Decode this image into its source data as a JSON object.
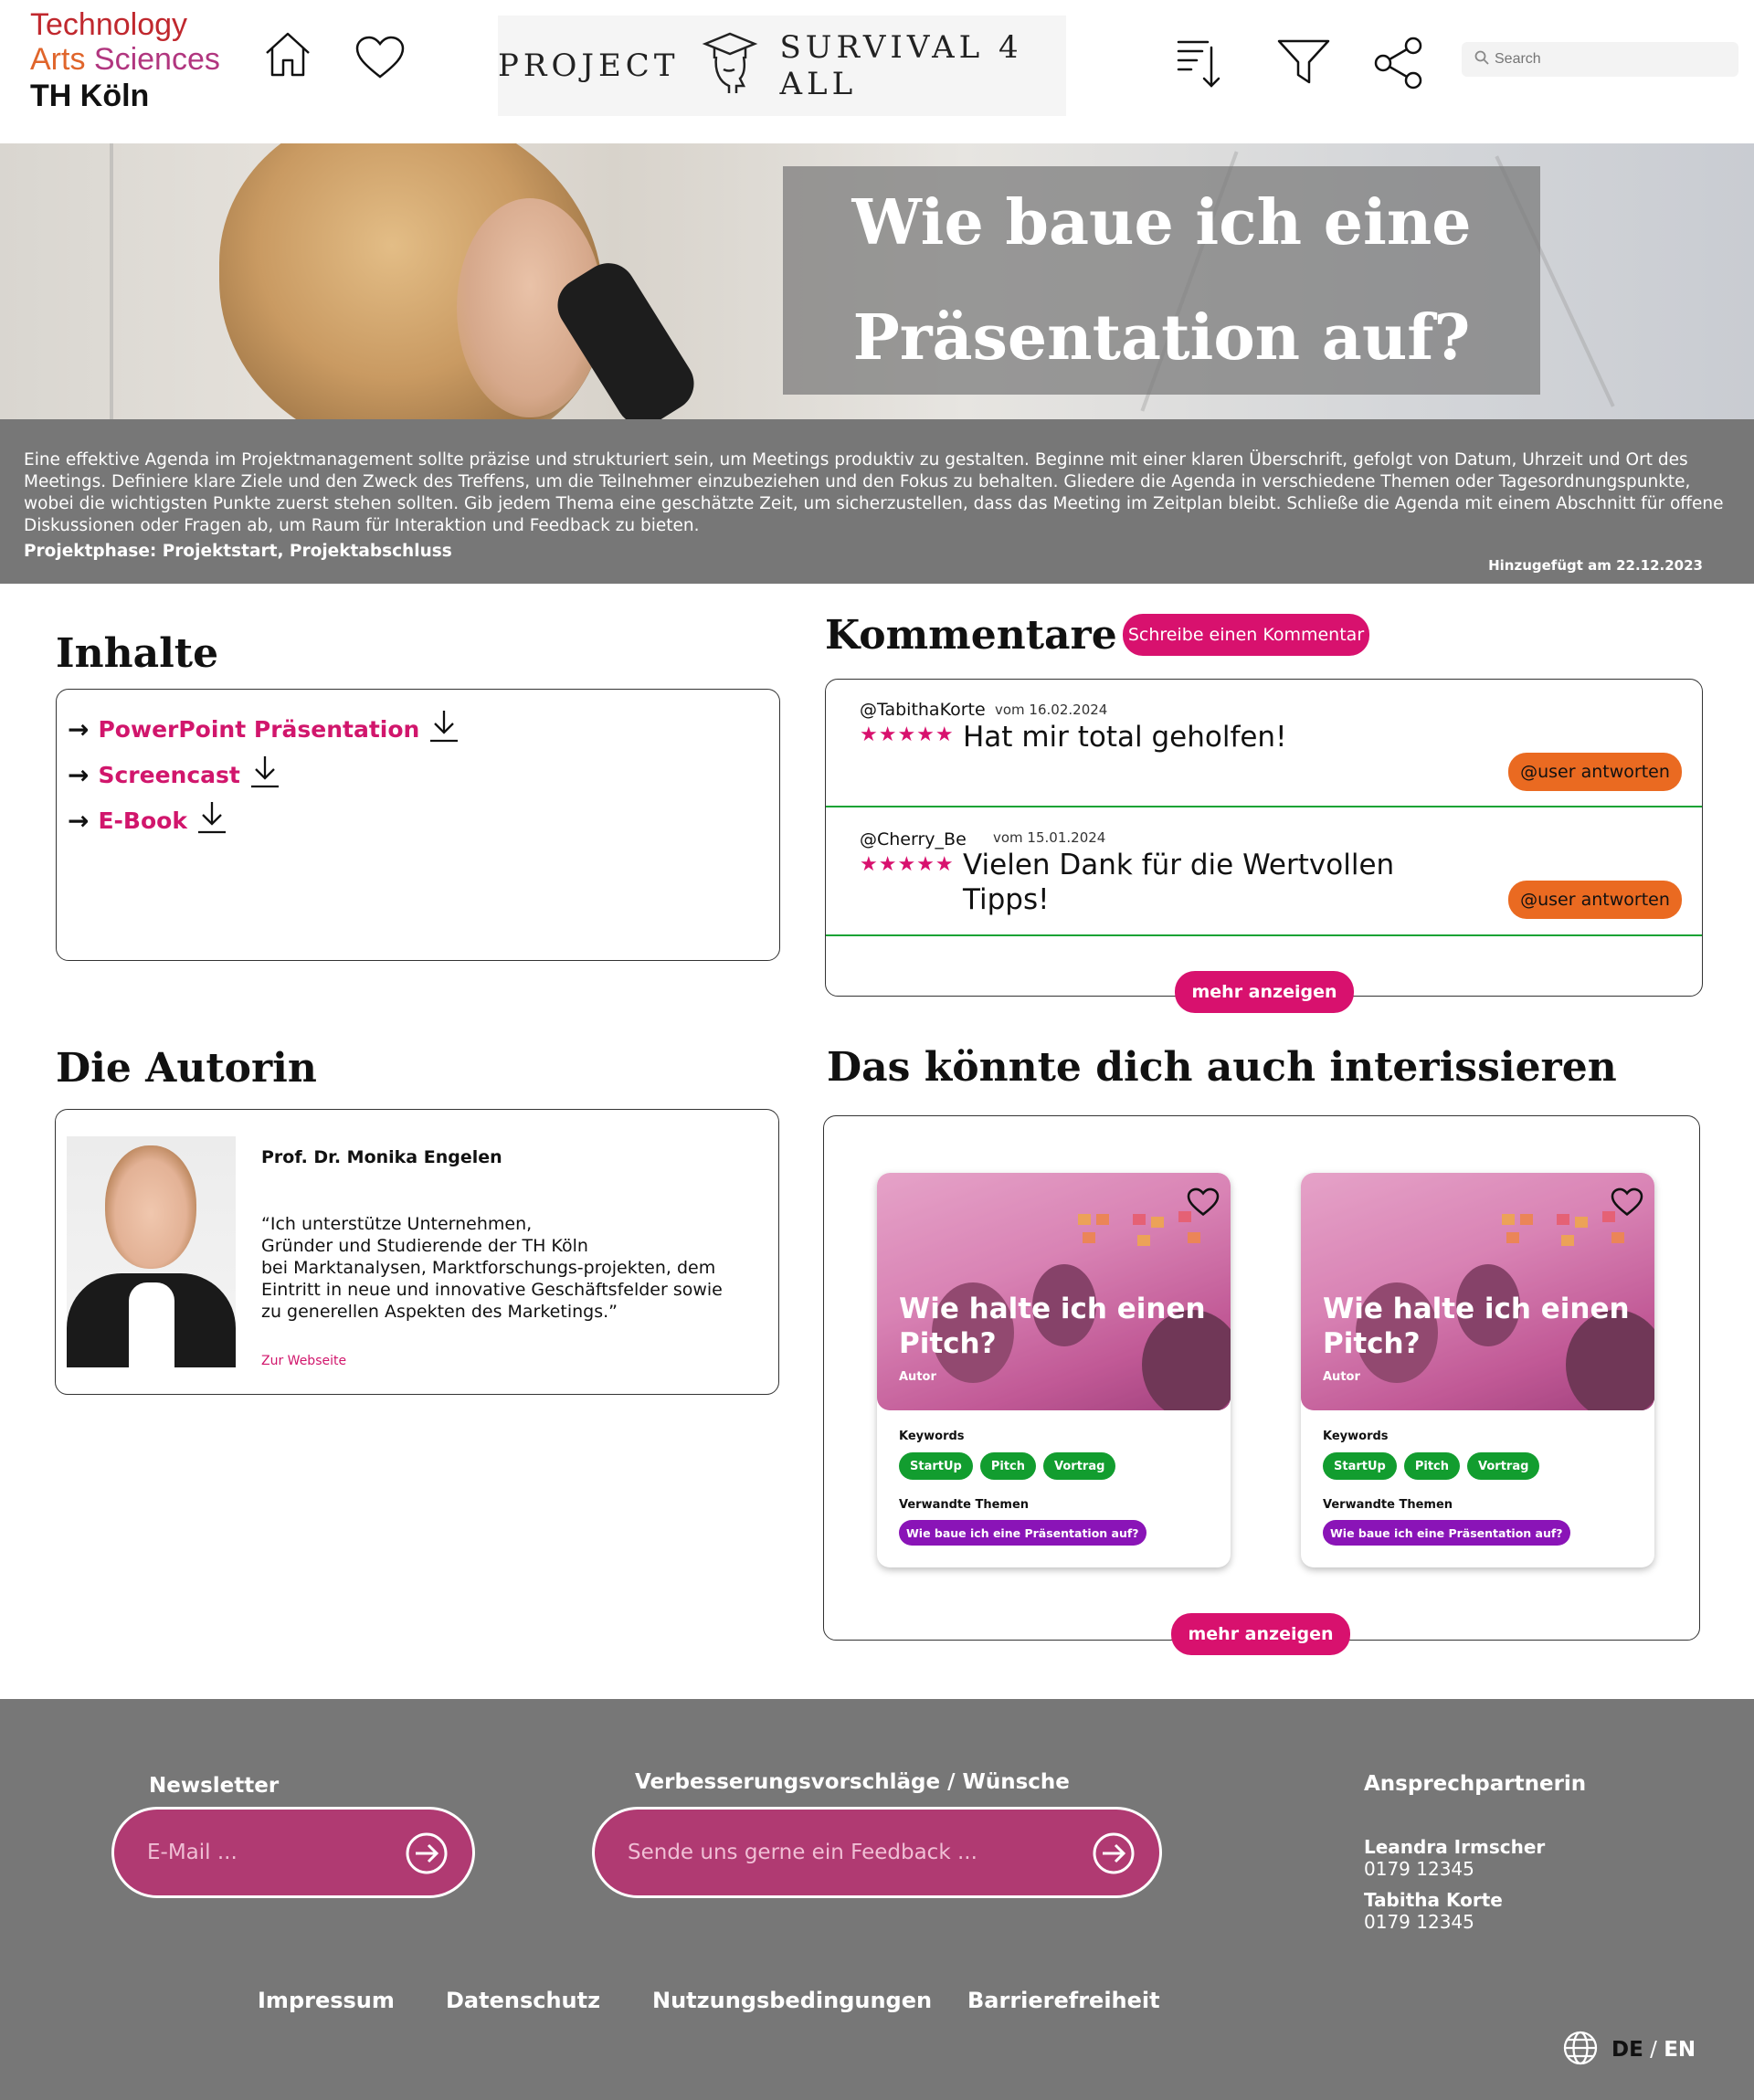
{
  "header": {
    "logo": {
      "line1": "Technology",
      "line2a": "Arts",
      "line2b": "Sciences",
      "line3": "TH Köln"
    },
    "brand": {
      "left": "PROJECT",
      "right": "SURVIVAL 4 ALL"
    },
    "search": {
      "placeholder": "Search"
    },
    "icons": [
      "home-icon",
      "heart-icon",
      "sort-icon",
      "filter-icon",
      "share-icon"
    ]
  },
  "hero": {
    "title": "Wie baue ich eine Präsentation auf?",
    "description": "Eine effektive Agenda im Projektmanagement sollte präzise und strukturiert sein, um Meetings produktiv zu gestalten. Beginne mit einer klaren Überschrift, gefolgt von Datum, Uhrzeit und Ort des Meetings. Definiere klare Ziele und den Zweck des Treffens, um die Teilnehmer einzubeziehen und den Fokus zu behalten. Gliedere die Agenda in verschiedene Themen oder Tagesordnungspunkte, wobei die wichtigsten Punkte zuerst stehen sollten. Gib jedem Thema eine geschätzte Zeit, um sicherzustellen, dass das Meeting im Zeitplan bleibt. Schließe die Agenda mit einem Abschnitt für offene Diskussionen oder Fragen ab, um Raum für Interaktion und Feedback zu bieten.",
    "phase": "Projektphase: Projektstart, Projektabschluss",
    "added": "Hinzugefügt am 22.12.2023"
  },
  "inhalte": {
    "heading": "Inhalte",
    "items": [
      {
        "label": "PowerPoint Präsentation"
      },
      {
        "label": "Screencast"
      },
      {
        "label": "E-Book"
      }
    ]
  },
  "kommentare": {
    "heading": "Kommentare",
    "write_button": "Schreibe einen Kommentar",
    "items": [
      {
        "user": "@TabithaKorte",
        "date": "vom 16.02.2024",
        "stars": "★★★★★",
        "text": "Hat mir total geholfen!",
        "reply": "@user antworten"
      },
      {
        "user": "@Cherry_Be",
        "date": "vom 15.01.2024",
        "stars": "★★★★★",
        "text": "Vielen Dank für die Wertvollen Tipps!",
        "reply": "@user antworten"
      }
    ],
    "more": "mehr anzeigen"
  },
  "autorin": {
    "heading": "Die Autorin",
    "name": "Prof. Dr. Monika Engelen",
    "quote_l1": "“Ich unterstütze Unternehmen,",
    "quote_l2": "Gründer und Studierende der TH Köln",
    "quote_l3": "bei Marktanalysen, Marktforschungs-projekten, dem",
    "quote_l4": "Eintritt in neue und innovative Geschäftsfelder sowie",
    "quote_l5": "zu generellen Aspekten des Marketings.”",
    "link": "Zur Webseite"
  },
  "empfehlungen": {
    "heading": "Das könnte dich auch interissieren",
    "cards": [
      {
        "title": "Wie halte ich einen Pitch?",
        "author_label": "Autor",
        "keywords_label": "Keywords",
        "keywords": [
          "StartUp",
          "Pitch",
          "Vortrag"
        ],
        "related_label": "Verwandte Themen",
        "related": "Wie baue ich eine Präsentation auf?"
      },
      {
        "title": "Wie halte ich einen Pitch?",
        "author_label": "Autor",
        "keywords_label": "Keywords",
        "keywords": [
          "StartUp",
          "Pitch",
          "Vortrag"
        ],
        "related_label": "Verwandte Themen",
        "related": "Wie baue ich eine Präsentation auf?"
      }
    ],
    "more": "mehr anzeigen"
  },
  "footer": {
    "newsletter_label": "Newsletter",
    "newsletter_placeholder": "E-Mail ...",
    "feedback_label": "Verbesserungsvorschläge / Wünsche",
    "feedback_placeholder": "Sende uns gerne ein Feedback ...",
    "contact_label": "Ansprechpartnerin",
    "contacts": [
      {
        "name": "Leandra Irmscher",
        "phone": "0179 12345"
      },
      {
        "name": "Tabitha Korte",
        "phone": "0179 12345"
      }
    ],
    "links": [
      "Impressum",
      "Datenschutz",
      "Nutzungsbedingungen",
      "Barrierefreiheit"
    ],
    "lang_de": "DE",
    "lang_sep": " / ",
    "lang_en": "EN"
  },
  "colors": {
    "accent": "#d8116e",
    "reply": "#ea6a21",
    "keyword": "#129d2f",
    "related": "#8a14b7",
    "footer": "#777777",
    "divider": "#17a334"
  }
}
